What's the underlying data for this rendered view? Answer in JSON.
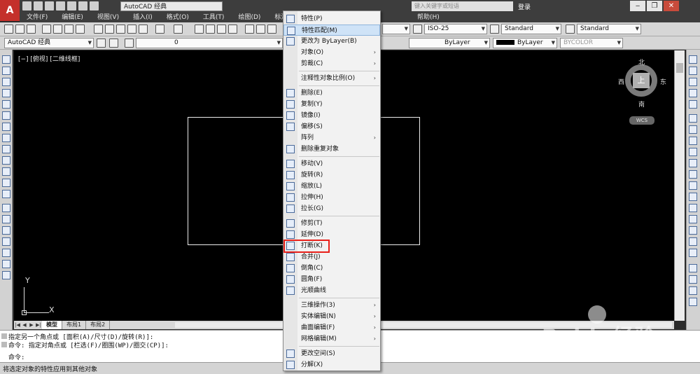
{
  "titlebar": {
    "workspace": "AutoCAD 经典",
    "search_placeholder": "键入关键字或短语",
    "login": "登录",
    "help_icon": "question-icon",
    "minimize": "‒",
    "restore": "❐",
    "close": "✕"
  },
  "menubar": [
    "文件(F)",
    "编辑(E)",
    "视图(V)",
    "插入(I)",
    "格式(O)",
    "工具(T)",
    "绘图(D)",
    "标注(N)"
  ],
  "menubar_help": "帮助(H)",
  "toolbar2": {
    "workspace_combo": "AutoCAD 经典",
    "layer_value": "0"
  },
  "properties": {
    "dimstyle": "ISO-25",
    "tablestyle": "Standard",
    "mleaderstyle": "Standard",
    "linetype": "ByLayer",
    "lineweight": "ByLayer",
    "plotstyle": "BYCOLOR"
  },
  "viewport": {
    "label": "[−] [俯视] [二维线框]",
    "viewcube": {
      "top": "上",
      "north": "北",
      "south": "南",
      "west": "西",
      "east": "东",
      "wcs": "WCS"
    },
    "ucs_x": "X",
    "ucs_y": "Y"
  },
  "layout_tabs": [
    "模型",
    "布局1",
    "布局2"
  ],
  "command": {
    "line1": "指定另一个角点或 [面积(A)/尺寸(D)/旋转(R)]:",
    "line2": "命令: 指定对角点或 [栏选(F)/圈围(WP)/圈交(CP)]:",
    "prompt": "命令:"
  },
  "status": "将选定对象的特性应用到其他对象",
  "context_menu": {
    "items": [
      {
        "label": "特性(P)",
        "icon": "properties-icon",
        "sub": false
      },
      {
        "label": "特性匹配(M)",
        "icon": "match-properties-icon",
        "sub": false,
        "hover": true
      },
      {
        "label": "更改为 ByLayer(B)",
        "icon": "bylayer-icon",
        "sub": false
      },
      {
        "label": "对象(O)",
        "icon": "",
        "sub": true
      },
      {
        "label": "剪裁(C)",
        "icon": "",
        "sub": true
      },
      {
        "sep": true
      },
      {
        "label": "注释性对象比例(O)",
        "icon": "",
        "sub": true
      },
      {
        "sep": true
      },
      {
        "label": "删除(E)",
        "icon": "erase-icon",
        "sub": false
      },
      {
        "label": "复制(Y)",
        "icon": "copy-icon",
        "sub": false
      },
      {
        "label": "镜像(I)",
        "icon": "mirror-icon",
        "sub": false
      },
      {
        "label": "偏移(S)",
        "icon": "offset-icon",
        "sub": false
      },
      {
        "label": "阵列",
        "icon": "",
        "sub": true
      },
      {
        "label": "删除重复对象",
        "icon": "overkill-icon",
        "sub": false
      },
      {
        "sep": true
      },
      {
        "label": "移动(V)",
        "icon": "move-icon",
        "sub": false
      },
      {
        "label": "旋转(R)",
        "icon": "rotate-icon",
        "sub": false
      },
      {
        "label": "缩放(L)",
        "icon": "scale-icon",
        "sub": false
      },
      {
        "label": "拉伸(H)",
        "icon": "stretch-icon",
        "sub": false
      },
      {
        "label": "拉长(G)",
        "icon": "lengthen-icon",
        "sub": false
      },
      {
        "sep": true
      },
      {
        "label": "修剪(T)",
        "icon": "trim-icon",
        "sub": false
      },
      {
        "label": "延伸(D)",
        "icon": "extend-icon",
        "sub": false
      },
      {
        "label": "打断(K)",
        "icon": "break-icon",
        "sub": false,
        "highlight": true
      },
      {
        "label": "合并(J)",
        "icon": "join-icon",
        "sub": false
      },
      {
        "label": "倒角(C)",
        "icon": "chamfer-icon",
        "sub": false
      },
      {
        "label": "圆角(F)",
        "icon": "fillet-icon",
        "sub": false
      },
      {
        "label": "光顺曲线",
        "icon": "blend-icon",
        "sub": false
      },
      {
        "sep": true
      },
      {
        "label": "三维操作(3)",
        "icon": "",
        "sub": true
      },
      {
        "label": "实体编辑(N)",
        "icon": "",
        "sub": true
      },
      {
        "label": "曲面编辑(F)",
        "icon": "",
        "sub": true
      },
      {
        "label": "网格编辑(M)",
        "icon": "",
        "sub": true
      },
      {
        "sep": true
      },
      {
        "label": "更改空间(S)",
        "icon": "chspace-icon",
        "sub": false
      },
      {
        "label": "分解(X)",
        "icon": "explode-icon",
        "sub": false
      }
    ]
  },
  "watermark": {
    "logo": "Baidu经验",
    "url": "jingyan.baidu.com"
  }
}
